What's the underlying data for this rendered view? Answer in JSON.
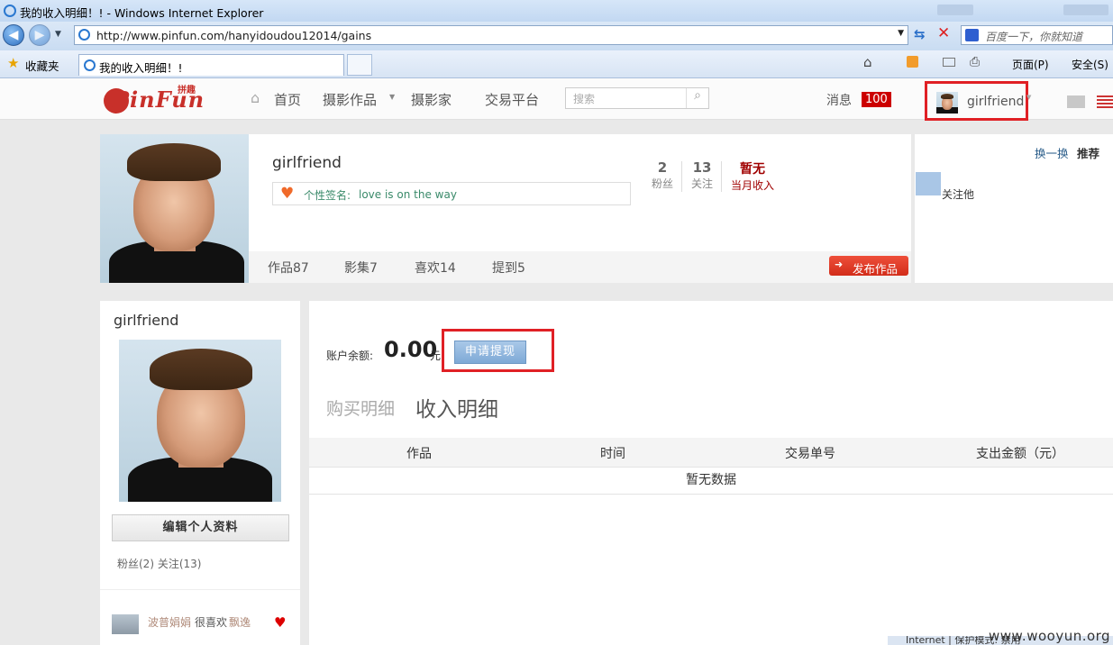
{
  "browser": {
    "window_title": "我的收入明细！! - Windows Internet Explorer",
    "url": "http://www.pinfun.com/hanyidoudou12014/gains",
    "search_placeholder": "百度一下，你就知道",
    "favorites_label": "收藏夹",
    "tab_title": "我的收入明细！!",
    "page_menu": "页面(P)",
    "safety_menu": "安全(S)"
  },
  "site": {
    "logo_text": "PinFun",
    "logo_small": "拼趣",
    "nav": [
      "首页",
      "摄影作品",
      "摄影家",
      "交易平台"
    ],
    "search_placeholder": "搜索",
    "messages_label": "消息",
    "messages_count": "100",
    "username": "girlfriend"
  },
  "profile": {
    "name": "girlfriend",
    "signature_label": "个性签名:",
    "signature": "love is on the way",
    "stats": [
      {
        "value": "2",
        "label": "粉丝"
      },
      {
        "value": "13",
        "label": "关注"
      },
      {
        "value": "暂无",
        "label": "当月收入"
      }
    ],
    "tabs": [
      "作品87",
      "影集7",
      "喜欢14",
      "提到5"
    ],
    "publish_button": "发布作品"
  },
  "recommend": {
    "refresh": "换一换",
    "title": "推荐",
    "follow_label": "关注他"
  },
  "sidebar": {
    "name": "girlfriend",
    "edit_button": "编辑个人资料",
    "follow_stats": "粉丝(2) 关注(13)",
    "activity_user": "波普娟娟",
    "activity_text": "很喜欢",
    "activity_target": "飘逸"
  },
  "account": {
    "balance_label": "账户余额:",
    "balance": "0.00",
    "currency": "元",
    "withdraw_button": "申请提现",
    "tabs": [
      "购买明细",
      "收入明细"
    ],
    "columns": [
      "作品",
      "时间",
      "交易单号",
      "支出金额（元）"
    ],
    "empty_text": "暂无数据"
  },
  "watermark": "www.wooyun.org",
  "status_text": "Internet | 保护模式: 禁用",
  "colors": {
    "accent_red": "#e02025",
    "brand_red": "#c8302a",
    "stat_red": "#a00000"
  }
}
